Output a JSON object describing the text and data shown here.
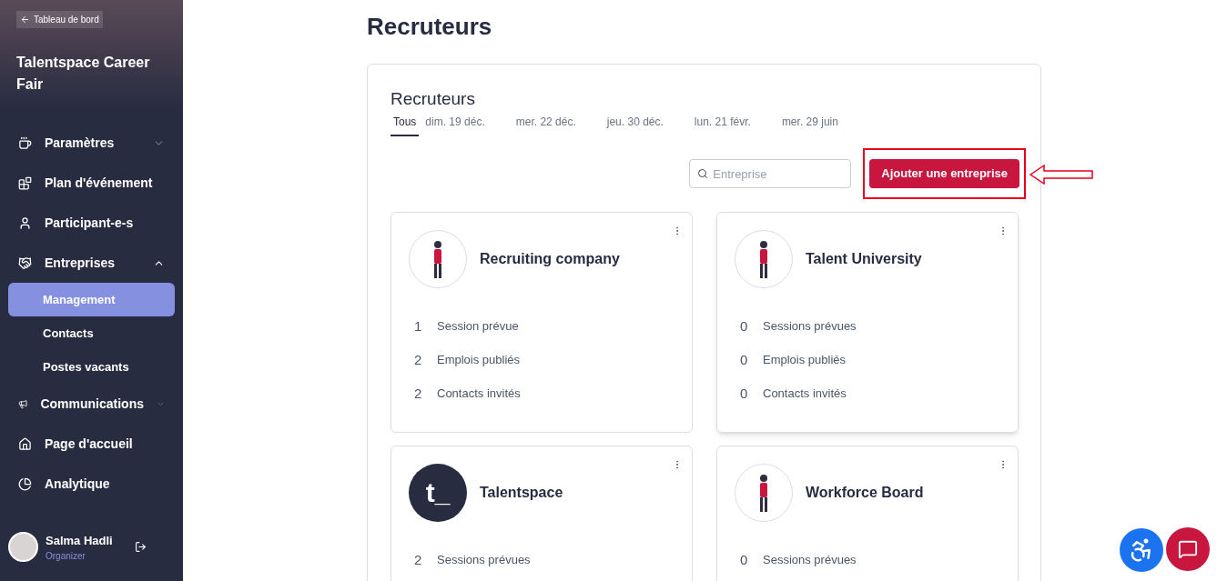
{
  "sidebar": {
    "back_link": "Tableau de bord",
    "event_title": "Talentspace Career Fair",
    "items": [
      {
        "label": "Paramètres",
        "expanded": false
      },
      {
        "label": "Plan d'événement"
      },
      {
        "label": "Participant-e-s"
      },
      {
        "label": "Entreprises",
        "expanded": true,
        "children": [
          {
            "label": "Management",
            "selected": true
          },
          {
            "label": "Contacts",
            "selected": false
          },
          {
            "label": "Postes vacants",
            "selected": false
          }
        ]
      },
      {
        "label": "Communications",
        "expanded": false
      },
      {
        "label": "Page d'accueil"
      },
      {
        "label": "Analytique"
      }
    ],
    "user": {
      "name": "Salma Hadli",
      "role": "Organizer"
    }
  },
  "page_title": "Recruteurs",
  "panel": {
    "title": "Recruteurs",
    "tabs": [
      {
        "label": "Tous",
        "selected": true
      },
      {
        "label": "dim. 19 déc.",
        "selected": false
      },
      {
        "label": "mer. 22 déc.",
        "selected": false
      },
      {
        "label": "jeu. 30 déc.",
        "selected": false
      },
      {
        "label": "lun. 21 févr.",
        "selected": false
      },
      {
        "label": "mer. 29 juin",
        "selected": false
      }
    ],
    "search": {
      "placeholder": "Entreprise"
    },
    "add_button": "Ajouter une entreprise",
    "companies": [
      {
        "name": "Recruiting company",
        "logo": {
          "kind": "illustration"
        },
        "stats": [
          {
            "count": "1",
            "label": "Session prévue"
          },
          {
            "count": "2",
            "label": "Emplois publiés"
          },
          {
            "count": "2",
            "label": "Contacts invités"
          }
        ]
      },
      {
        "name": "Talent University",
        "logo": {
          "kind": "illustration"
        },
        "stats": [
          {
            "count": "0",
            "label": "Sessions prévues"
          },
          {
            "count": "0",
            "label": "Emplois publiés"
          },
          {
            "count": "0",
            "label": "Contacts invités"
          }
        ]
      },
      {
        "name": "Talentspace",
        "logo": {
          "kind": "monogram",
          "text": "t_"
        },
        "stats": [
          {
            "count": "2",
            "label": "Sessions prévues"
          }
        ]
      },
      {
        "name": "Workforce Board",
        "logo": {
          "kind": "illustration"
        },
        "stats": [
          {
            "count": "0",
            "label": "Sessions prévues"
          }
        ]
      }
    ]
  }
}
